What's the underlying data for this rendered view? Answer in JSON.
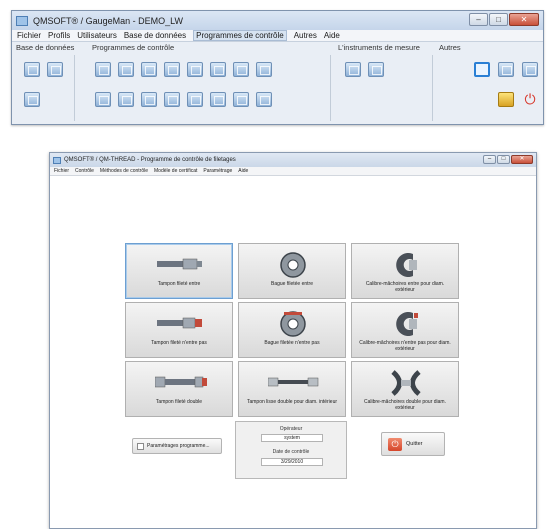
{
  "main_window": {
    "title": "QMSOFT® / GaugeMan - DEMO_LW",
    "menu": [
      "Fichier",
      "Profils",
      "Utilisateurs",
      "Base de données",
      "Programmes de contrôle",
      "Autres",
      "Aide"
    ],
    "active_menu_index": 4,
    "groups": {
      "databases": "Base de données",
      "programs": "Programmes de contrôle",
      "instruments": "L'instruments de mesure",
      "others": "Autres"
    },
    "window_controls": {
      "minimize": "–",
      "maximize": "□",
      "close": "✕"
    }
  },
  "thread_window": {
    "title": "QMSOFT® / QM-THREAD - Programme de contrôle de filetages",
    "menu": [
      "Fichier",
      "Contrôle",
      "Méthodes de contrôle",
      "Modèle de certificat",
      "Paramétrage",
      "Aide"
    ],
    "window_controls": {
      "minimize": "–",
      "maximize": "□",
      "close": "✕"
    },
    "tiles": [
      {
        "label": "Tampon fileté entre",
        "icon": "thread-plug-go-icon"
      },
      {
        "label": "Bague filetée entre",
        "icon": "thread-ring-go-icon"
      },
      {
        "label": "Calibre-mâchoires entre pour diam. extérieur",
        "icon": "snap-gauge-go-icon"
      },
      {
        "label": "Tampon fileté n'entre pas",
        "icon": "thread-plug-nogo-icon"
      },
      {
        "label": "Bague filetée n'entre pas",
        "icon": "thread-ring-nogo-icon"
      },
      {
        "label": "Calibre-mâchoires n'entre pas pour diam. extérieur",
        "icon": "snap-gauge-nogo-icon"
      },
      {
        "label": "Tampon fileté double",
        "icon": "double-thread-plug-icon"
      },
      {
        "label": "Tampon lisse double pour diam. intérieur",
        "icon": "double-plain-plug-icon"
      },
      {
        "label": "Calibre-mâchoires double pour diam. extérieur",
        "icon": "double-snap-gauge-icon"
      }
    ],
    "settings_button": "Paramétrages programme...",
    "operator_label": "Opérateur",
    "operator_value": "system",
    "date_label": "Date de contrôle",
    "date_value": "3/29/2010",
    "quit_label": "Quitter",
    "colors": {
      "quit_red": "#d5452a",
      "selection_blue": "#6d9fd1"
    }
  }
}
